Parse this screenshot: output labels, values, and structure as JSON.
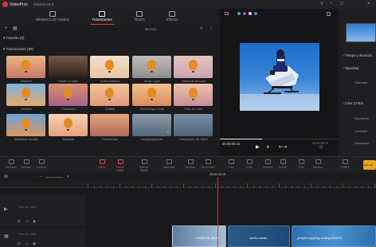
{
  "app": {
    "name": "VideoProc",
    "version": "202419.23-0"
  },
  "tabs": [
    {
      "label": "Biblioteca de medios"
    },
    {
      "label": "Transiciones"
    },
    {
      "label": "Títulos"
    },
    {
      "label": "Efectos"
    }
  ],
  "library": {
    "search_placeholder": "Buscar..."
  },
  "sections": {
    "favorites": "Favorito (0)",
    "transitions": "Transiciones (89)"
  },
  "thumbs": [
    {
      "label": "Disparar"
    },
    {
      "label": "Fundir a negro"
    },
    {
      "label": "fundir a blanco"
    },
    {
      "label": "fundir a gris"
    },
    {
      "label": "Distancia de color"
    },
    {
      "label": "Disolver"
    },
    {
      "label": "Fantástico"
    },
    {
      "label": "Ondear"
    },
    {
      "label": "Desenfoque lineal"
    },
    {
      "label": "Paso de color"
    },
    {
      "label": "Multiplicar escalar"
    },
    {
      "label": "Aluminar"
    },
    {
      "label": "Transformar"
    },
    {
      "label": "Desplazamiento"
    },
    {
      "label": "Desplazam. de Glitch"
    }
  ],
  "preview": {
    "current_time": "00:00:09.10",
    "total_time": "00:00:25.73"
  },
  "right_panel": {
    "sections": [
      "Tiempo y duración",
      "Opacidad",
      "Color y Filtro"
    ],
    "opacity_label": "Opacidad",
    "color_items": [
      "Exposición",
      "Contraste",
      "Saturación"
    ]
  },
  "toolbar": {
    "items": [
      "Deshacer",
      "Rehacer",
      "Eliminar",
      "Dividir",
      "Dividir Audio",
      "Edición Rápida",
      "Velocidad",
      "Recortar",
      "Movimiento",
      "Color",
      "Estilo",
      "Volumen",
      "Grabar",
      "Texto",
      "Mosaico",
      "GRBRP"
    ]
  },
  "timeline": {
    "playhead_time": "00:00:09.10"
  },
  "tracks": [
    {
      "name": "Track de vídeo",
      "label": "track-1"
    },
    {
      "name": "Track de audio",
      "label": "track-2"
    }
  ],
  "clips": [
    {
      "label": "17695139_Moti..."
    },
    {
      "label": "surfer-ocean"
    },
    {
      "label": "people-enjoying-surfing-942573"
    }
  ],
  "export_label": "Exportar",
  "colors": {
    "accent": "#e03434",
    "video_sky": "#3a86d8",
    "balloon": "#e58a25"
  }
}
